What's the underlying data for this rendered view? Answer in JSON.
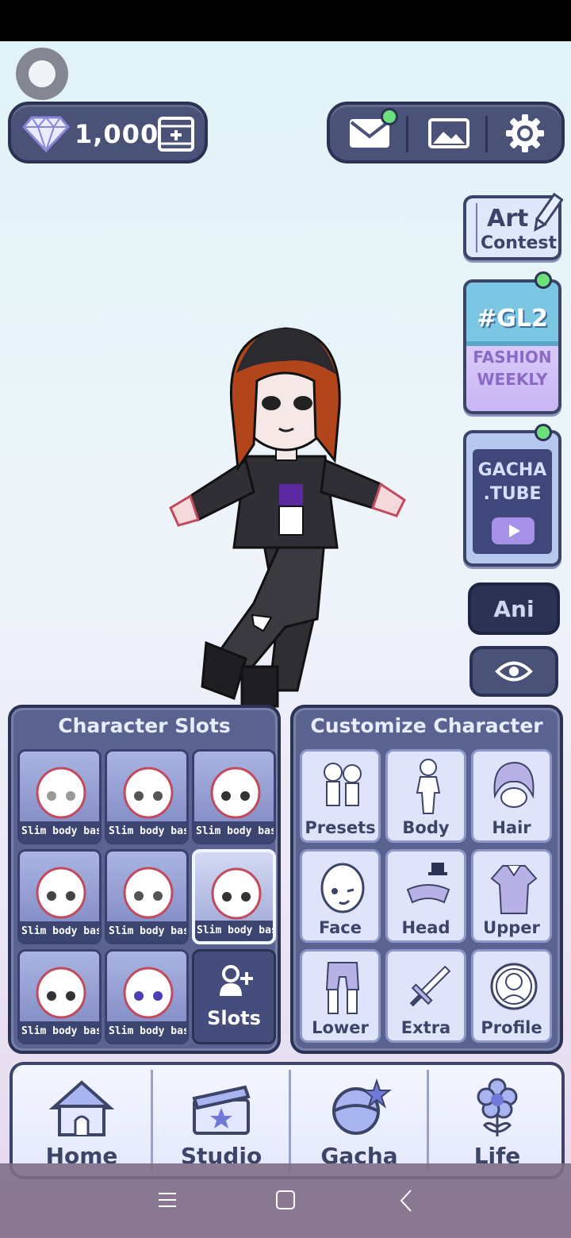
{
  "currency": {
    "gems": "1,000"
  },
  "side_buttons": {
    "art_contest_line1": "Art",
    "art_contest_line2": "Contest",
    "gl2_tag": "#GL2",
    "gl2_line1": "FASHION",
    "gl2_line2": "WEEKLY",
    "gacha_tube_line1": "GACHA",
    "gacha_tube_line2": ".TUBE",
    "ani_label": "Ani"
  },
  "character_slots": {
    "title": "Character Slots",
    "slots": [
      {
        "label": "Slim body bas"
      },
      {
        "label": "Slim body bas"
      },
      {
        "label": "Slim body bas"
      },
      {
        "label": "Slim body bas"
      },
      {
        "label": "Slim body bas"
      },
      {
        "label": "Slim body bas"
      },
      {
        "label": "Slim body bas"
      },
      {
        "label": "Slim body bas"
      }
    ],
    "add_label": "Slots"
  },
  "customize": {
    "title": "Customize Character",
    "items": [
      {
        "label": "Presets"
      },
      {
        "label": "Body"
      },
      {
        "label": "Hair"
      },
      {
        "label": "Face"
      },
      {
        "label": "Head"
      },
      {
        "label": "Upper"
      },
      {
        "label": "Lower"
      },
      {
        "label": "Extra"
      },
      {
        "label": "Profile"
      }
    ]
  },
  "bottom_nav": [
    {
      "label": "Home"
    },
    {
      "label": "Studio"
    },
    {
      "label": "Gacha"
    },
    {
      "label": "Life"
    }
  ],
  "colors": {
    "panel": "#5a6290",
    "panel_border": "#2c3254",
    "notification": "#6be07a",
    "accent_purple": "#a591e8"
  }
}
